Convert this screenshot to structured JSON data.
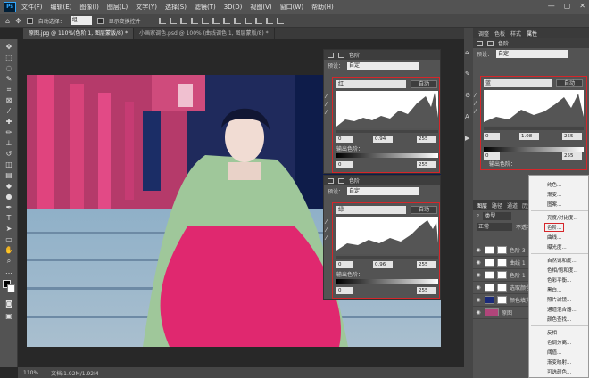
{
  "app": {
    "logo": "Ps",
    "menu": [
      "文件(F)",
      "编辑(E)",
      "图像(I)",
      "图层(L)",
      "文字(Y)",
      "选择(S)",
      "滤镜(T)",
      "3D(D)",
      "视图(V)",
      "窗口(W)",
      "帮助(H)"
    ],
    "window_controls": [
      "—",
      "▢",
      "✕"
    ]
  },
  "options": {
    "auto_select_label": "自动选择：",
    "auto_select_value": "组",
    "show_transform_label": "显示变换控件"
  },
  "tabs": [
    "原图.jpg @ 110%(色阶 1, 图层蒙版/8) *",
    "小画家调色.psd @ 100% (曲线调色 1, 图层蒙版/8) *"
  ],
  "status": {
    "zoom": "110%",
    "doc": "文档:1.92M/1.92M"
  },
  "levels1": {
    "header": "色阶",
    "preset_label": "预设：",
    "preset_value": "自定",
    "channel": "红",
    "auto_label": "自动",
    "input_black": "0",
    "input_gamma": "0.94",
    "input_white": "255",
    "output_label": "输出色阶：",
    "output_black": "0",
    "output_white": "255"
  },
  "levels2": {
    "header": "色阶",
    "preset_label": "预设：",
    "preset_value": "自定",
    "channel": "绿",
    "auto_label": "自动",
    "input_black": "0",
    "input_gamma": "0.96",
    "input_white": "255",
    "output_label": "输出色阶：",
    "output_black": "0",
    "output_white": "255"
  },
  "rpanel_tabs": [
    "调整",
    "色板",
    "样式",
    "属性"
  ],
  "props": {
    "header": "色阶",
    "preset_label": "预设：",
    "preset_value": "自定",
    "channel": "蓝",
    "auto_label": "自动",
    "input_black": "0",
    "input_gamma": "1.08",
    "input_white": "255",
    "output_label": "输出色阶：",
    "output_black": "0",
    "output_white": "255"
  },
  "layers_tabs": [
    "图层",
    "路径",
    "通道",
    "历史",
    "动作"
  ],
  "layers_filter": "类型",
  "blend": "正常",
  "opacity_label": "不透明度：",
  "layers": [
    {
      "name": "色阶 3"
    },
    {
      "name": "曲线 1"
    },
    {
      "name": "色阶 1"
    },
    {
      "name": "选取颜色"
    },
    {
      "name": "颜色填充"
    },
    {
      "name": "原图"
    }
  ],
  "context_menu": [
    "纯色...",
    "渐变...",
    "图案...",
    "亮度/对比度...",
    "色阶...",
    "曲线...",
    "曝光度...",
    "自然饱和度...",
    "色相/饱和度...",
    "色彩平衡...",
    "黑白...",
    "照片滤镜...",
    "通道混合器...",
    "颜色查找...",
    "反相",
    "色调分离...",
    "阈值...",
    "渐变映射...",
    "可选颜色..."
  ]
}
